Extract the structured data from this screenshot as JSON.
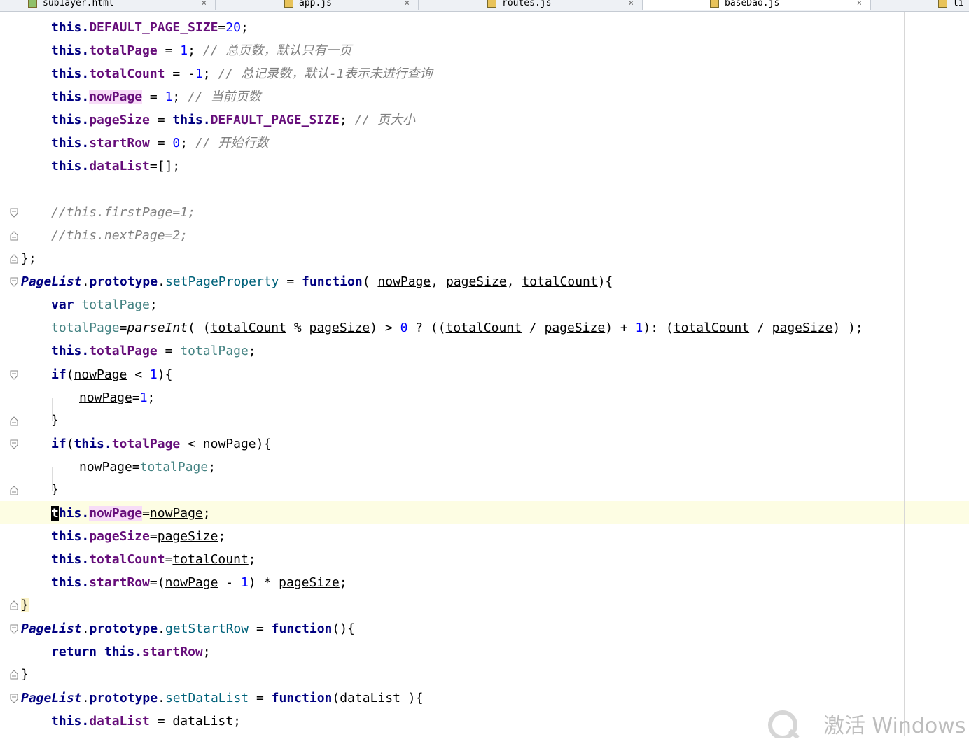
{
  "tabs": [
    {
      "label": "sub1ayer.html",
      "icon": "html-file-icon",
      "active": false
    },
    {
      "label": "app.js",
      "icon": "js-file-icon",
      "active": false
    },
    {
      "label": "routes.js",
      "icon": "js-file-icon",
      "active": false
    },
    {
      "label": "baseDao.js",
      "icon": "js-file-icon",
      "active": true
    },
    {
      "label": "li",
      "icon": "js-file-icon",
      "active": false
    }
  ],
  "close_glyph": "×",
  "watermark": "激活 Windows",
  "code": {
    "l1": {
      "a": "this.",
      "b": "DEFAULT_PAGE_SIZE",
      "c": "=",
      "d": "20",
      "e": ";"
    },
    "l2": {
      "a": "this.",
      "b": "totalPage",
      "c": " = ",
      "d": "1",
      "e": "; ",
      "f": "// 总页数，默认只有一页"
    },
    "l3": {
      "a": "this.",
      "b": "totalCount",
      "c": " = -",
      "d": "1",
      "e": "; ",
      "f": "// 总记录数，默认-1表示未进行查询"
    },
    "l4": {
      "a": "this.",
      "b": "nowPage",
      "c": " = ",
      "d": "1",
      "e": "; ",
      "f": "// 当前页数"
    },
    "l5": {
      "a": "this.",
      "b": "pageSize",
      "c": " = ",
      "d": "this.",
      "e": "DEFAULT_PAGE_SIZE",
      "f": "; ",
      "g": "// 页大小"
    },
    "l6": {
      "a": "this.",
      "b": "startRow",
      "c": " = ",
      "d": "0",
      "e": "; ",
      "f": "// 开始行数"
    },
    "l7": {
      "a": "this.",
      "b": "dataList",
      "c": "=[];"
    },
    "l9": {
      "a": "//this.firstPage=1;"
    },
    "l10": {
      "a": "//this.nextPage=2;"
    },
    "l11": {
      "a": "};"
    },
    "l12": {
      "a": "PageList",
      "b": ".",
      "c": "prototype",
      "d": ".",
      "e": "setPageProperty",
      "f": " = ",
      "g": "function",
      "h": "( ",
      "i": "nowPage",
      "j": ", ",
      "k": "pageSize",
      "l": ", ",
      "m": "totalCount",
      "n": "){"
    },
    "l13": {
      "a": "var ",
      "b": "totalPage",
      "c": ";"
    },
    "l14": {
      "a": "totalPage",
      "b": "=",
      "c": "parseInt",
      "d": "( (",
      "e": "totalCount",
      "f": " % ",
      "g": "pageSize",
      "h": ") > ",
      "i": "0",
      "j": " ? ((",
      "k": "totalCount",
      "l": " / ",
      "m": "pageSize",
      "n": ") + ",
      "o": "1",
      "p": "): (",
      "q": "totalCount",
      "r": " / ",
      "s": "pageSize",
      "t": ") );"
    },
    "l15": {
      "a": "this.",
      "b": "totalPage",
      "c": " = ",
      "d": "totalPage",
      "e": ";"
    },
    "l16": {
      "a": "if",
      "b": "(",
      "c": "nowPage",
      "d": " < ",
      "e": "1",
      "f": "){"
    },
    "l17": {
      "a": "nowPage",
      "b": "=",
      "c": "1",
      "d": ";"
    },
    "l18": {
      "a": "}"
    },
    "l19": {
      "a": "if",
      "b": "(",
      "c": "this.",
      "d": "totalPage",
      "e": " < ",
      "f": "nowPage",
      "g": "){"
    },
    "l20": {
      "a": "nowPage",
      "b": "=",
      "c": "totalPage",
      "d": ";"
    },
    "l21": {
      "a": "}"
    },
    "l22": {
      "a0": "t",
      "a": "his.",
      "b": "nowPage",
      "c": "=",
      "d": "nowPage",
      "e": ";"
    },
    "l23": {
      "a": "this.",
      "b": "pageSize",
      "c": "=",
      "d": "pageSize",
      "e": ";"
    },
    "l24": {
      "a": "this.",
      "b": "totalCount",
      "c": "=",
      "d": "totalCount",
      "e": ";"
    },
    "l25": {
      "a": "this.",
      "b": "startRow",
      "c": "=(",
      "d": "nowPage",
      "e": " - ",
      "f": "1",
      "g": ") * ",
      "h": "pageSize",
      "i": ";"
    },
    "l26": {
      "a": "}"
    },
    "l27": {
      "a": "PageList",
      "b": ".",
      "c": "prototype",
      "d": ".",
      "e": "getStartRow",
      "f": " = ",
      "g": "function",
      "h": "(){"
    },
    "l28": {
      "a": "return ",
      "b": "this.",
      "c": "startRow",
      "d": ";"
    },
    "l29": {
      "a": "}"
    },
    "l30": {
      "a": "PageList",
      "b": ".",
      "c": "prototype",
      "d": ".",
      "e": "setDataList",
      "f": " = ",
      "g": "function",
      "h": "(",
      "i": "dataList",
      "j": " ){"
    },
    "l31": {
      "a": "this.",
      "b": "dataList",
      "c": " = ",
      "d": "dataList",
      "e": ";"
    }
  }
}
